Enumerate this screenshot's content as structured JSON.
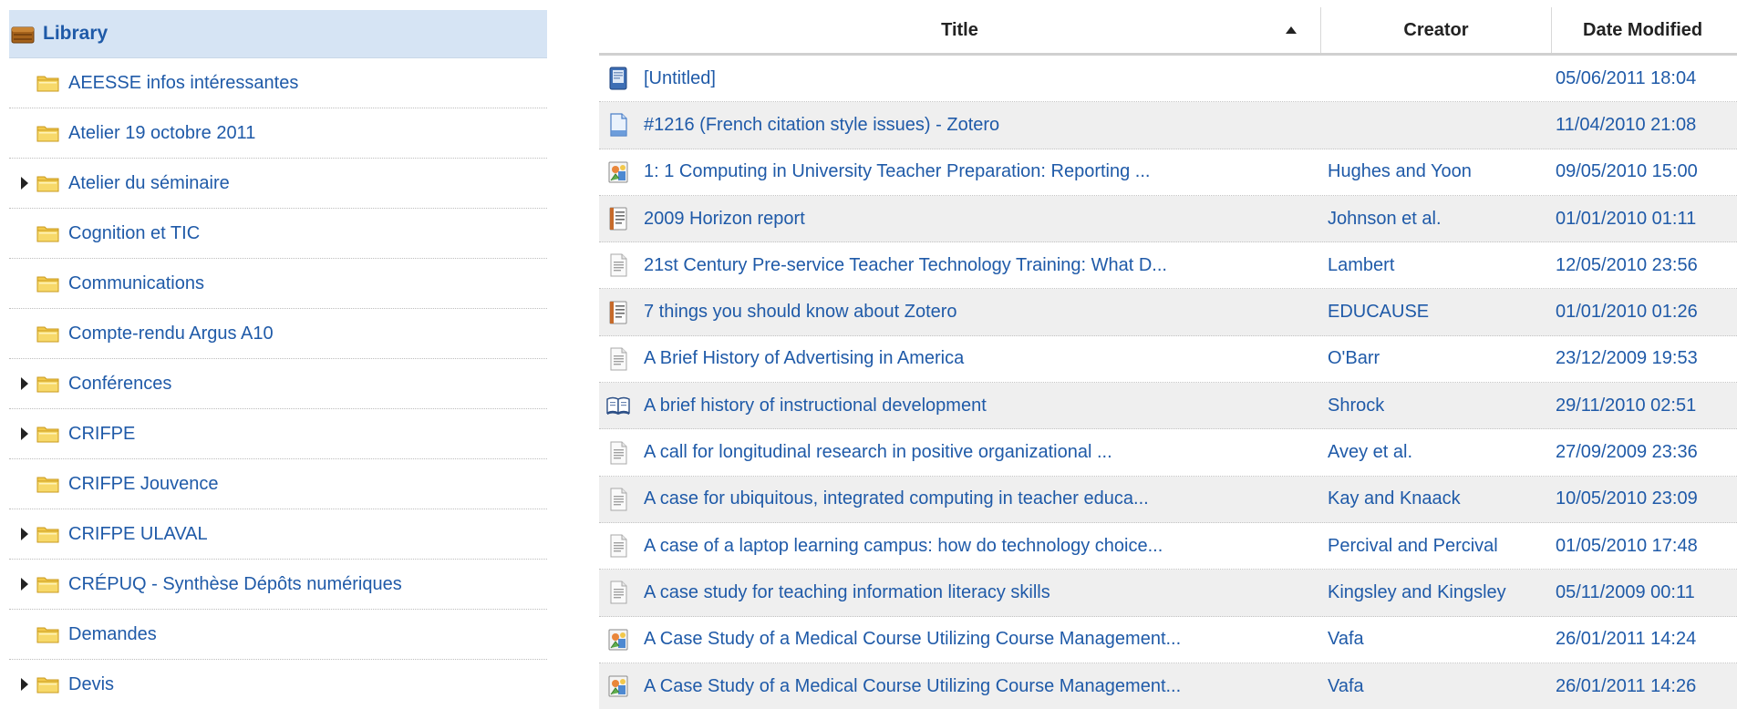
{
  "library": {
    "label": "Library"
  },
  "collections": [
    {
      "label": "AEESSE infos intéressantes",
      "expandable": false
    },
    {
      "label": "Atelier 19 octobre 2011",
      "expandable": false
    },
    {
      "label": "Atelier du séminaire",
      "expandable": true
    },
    {
      "label": "Cognition et TIC",
      "expandable": false
    },
    {
      "label": "Communications",
      "expandable": false
    },
    {
      "label": "Compte-rendu Argus A10",
      "expandable": false
    },
    {
      "label": "Conférences",
      "expandable": true
    },
    {
      "label": "CRIFPE",
      "expandable": true
    },
    {
      "label": "CRIFPE Jouvence",
      "expandable": false
    },
    {
      "label": "CRIFPE ULAVAL",
      "expandable": true
    },
    {
      "label": "CRÉPUQ - Synthèse Dépôts numériques",
      "expandable": true
    },
    {
      "label": "Demandes",
      "expandable": false
    },
    {
      "label": "Devis",
      "expandable": true
    }
  ],
  "columns": {
    "title": "Title",
    "creator": "Creator",
    "date": "Date Modified",
    "sort": "ascending"
  },
  "items": [
    {
      "icon": "book-blue-icon",
      "title": "[Untitled]",
      "creator": "",
      "date": "05/06/2011 18:04"
    },
    {
      "icon": "webpage-icon",
      "title": "#1216 (French citation style issues) - Zotero",
      "creator": "",
      "date": "11/04/2010 21:08"
    },
    {
      "icon": "presentation-icon",
      "title": "1: 1 Computing in University Teacher Preparation: Reporting ...",
      "creator": "Hughes and Yoon",
      "date": "09/05/2010 15:00"
    },
    {
      "icon": "report-icon",
      "title": "2009 Horizon report",
      "creator": "Johnson et al.",
      "date": "01/01/2010 01:11"
    },
    {
      "icon": "document-icon",
      "title": "21st Century Pre-service Teacher Technology Training: What D...",
      "creator": "Lambert",
      "date": "12/05/2010 23:56"
    },
    {
      "icon": "report-icon",
      "title": "7 things you should know about Zotero",
      "creator": "EDUCAUSE",
      "date": "01/01/2010 01:26"
    },
    {
      "icon": "document-icon",
      "title": "A Brief History of Advertising in America",
      "creator": "O'Barr",
      "date": "23/12/2009 19:53"
    },
    {
      "icon": "open-book-icon",
      "title": "A brief history of instructional development",
      "creator": "Shrock",
      "date": "29/11/2010 02:51"
    },
    {
      "icon": "document-icon",
      "title": "A call for longitudinal research in positive organizational ...",
      "creator": "Avey et al.",
      "date": "27/09/2009 23:36"
    },
    {
      "icon": "document-icon",
      "title": "A case for ubiquitous, integrated computing in teacher educa...",
      "creator": "Kay and Knaack",
      "date": "10/05/2010 23:09"
    },
    {
      "icon": "document-icon",
      "title": "A case of a laptop learning campus: how do technology choice...",
      "creator": "Percival and Percival",
      "date": "01/05/2010 17:48"
    },
    {
      "icon": "document-icon",
      "title": "A case study for teaching information literacy skills",
      "creator": "Kingsley and Kingsley",
      "date": "05/11/2009 00:11"
    },
    {
      "icon": "presentation-icon",
      "title": "A Case Study of a Medical Course Utilizing Course Management...",
      "creator": "Vafa",
      "date": "26/01/2011 14:24"
    },
    {
      "icon": "presentation-icon",
      "title": "A Case Study of a Medical Course Utilizing Course Management...",
      "creator": "Vafa",
      "date": "26/01/2011 14:26"
    }
  ]
}
